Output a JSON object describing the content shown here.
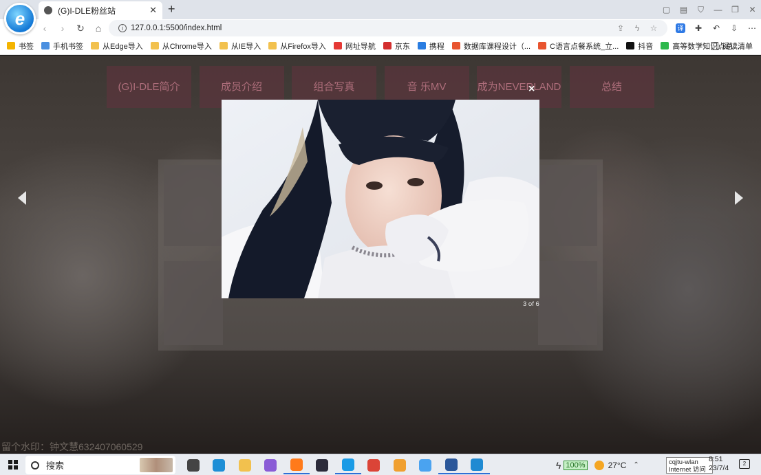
{
  "browser": {
    "tab_title": "(G)I-DLE粉丝站",
    "new_tab": "+",
    "url": "127.0.0.1:5500/index.html",
    "bookmarks": [
      {
        "label": "书签",
        "color": "#f4b400"
      },
      {
        "label": "手机书签",
        "color": "#4a8fe0"
      },
      {
        "label": "从Edge导入",
        "color": "#f2c14e"
      },
      {
        "label": "从Chrome导入",
        "color": "#f2c14e"
      },
      {
        "label": "从IE导入",
        "color": "#f2c14e"
      },
      {
        "label": "从Firefox导入",
        "color": "#f2c14e"
      },
      {
        "label": "网址导航",
        "color": "#e53935"
      },
      {
        "label": "京东",
        "color": "#d32f2f"
      },
      {
        "label": "携程",
        "color": "#2a7de1"
      },
      {
        "label": "数据库课程设计（...",
        "color": "#e8542f"
      },
      {
        "label": "C语言点餐系统_立...",
        "color": "#e8542f"
      },
      {
        "label": "抖音",
        "color": "#111111"
      },
      {
        "label": "高等数学知识点总...",
        "color": "#2db84d"
      }
    ],
    "bookmarks_more": "»",
    "reading_list": "阅读清单"
  },
  "site": {
    "menu": [
      "(G)I-DLE简介",
      "成员介绍",
      "组合写真",
      "音 乐MV",
      "成为NEVERLAND",
      "总结"
    ],
    "watermark": "留个水印：钟文慧632407060529"
  },
  "lightbox": {
    "close": "×",
    "counter": "3 of 6"
  },
  "taskbar": {
    "search_label": "搜索",
    "battery": "100%",
    "temperature": "27°C",
    "network_tooltip_line1": "cqjtu-wlan",
    "network_tooltip_line2": "Internet 访问",
    "time": "8:51",
    "date": "23/7/4",
    "notifications": "2",
    "apps": [
      {
        "name": "task-view",
        "color": "#444444"
      },
      {
        "name": "edge",
        "color": "#1e8fd6"
      },
      {
        "name": "file-explorer",
        "color": "#f2c14e"
      },
      {
        "name": "copilot",
        "color": "#8a5cd6"
      },
      {
        "name": "firefox",
        "color": "#ff7a1a"
      },
      {
        "name": "terminal",
        "color": "#2b2b3a"
      },
      {
        "name": "ie-browser",
        "color": "#1a9be6"
      },
      {
        "name": "chrome",
        "color": "#db4437"
      },
      {
        "name": "app-orange",
        "color": "#f0a030"
      },
      {
        "name": "app-blue",
        "color": "#4aa3f0"
      },
      {
        "name": "word",
        "color": "#2b579a"
      },
      {
        "name": "vscode",
        "color": "#1f8ad2"
      }
    ]
  }
}
